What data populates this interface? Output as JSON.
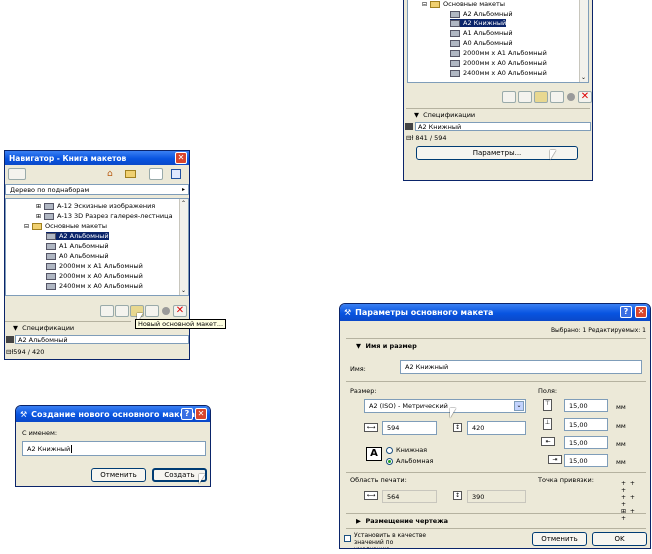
{
  "top_window": {
    "tree_root": "Основные макеты",
    "items": [
      "A2 Альбомный",
      "A2 Книжный",
      "A1 Альбомный",
      "A0 Альбомный",
      "2000мм x A1 Альбомный",
      "2000мм x A0 Альбомный",
      "2400мм x A0 Альбомный"
    ],
    "section_label": "Спецификации",
    "spec_name": "A2 Книжный",
    "spec_size": "841 / 594",
    "params_button": "Параметры..."
  },
  "navigator": {
    "title": "Навигатор - Книга макетов",
    "view_select": "Дерево по поднаборам",
    "tree_items": [
      "A-12 Эскизные изображения",
      "A-13 3D Разрез галерея-лестница",
      "Основные макеты",
      "A2 Альбомный",
      "A1 Альбомный",
      "A0 Альбомный",
      "2000мм x A1 Альбомный",
      "2000мм x A0 Альбомный",
      "2400мм x A0 Альбомный"
    ],
    "tooltip": "Новый основной макет...",
    "section_label": "Спецификации",
    "spec_name": "A2 Альбомный",
    "spec_size": "594 / 420"
  },
  "create_dialog": {
    "title": "Создание нового основного макета",
    "name_label": "С именем:",
    "name_value": "A2 Книжный",
    "cancel": "Отменить",
    "create": "Создать"
  },
  "params_dialog": {
    "title": "Параметры основного макета",
    "status": "Выбрано: 1 Редактируемых: 1",
    "section_name": "Имя и размер",
    "name_label": "Имя:",
    "name_value": "A2 Книжный",
    "size_label": "Размер:",
    "size_value": "A2 (ISO) - Метрический",
    "width": "594",
    "height": "420",
    "orientation_portrait": "Книжная",
    "orientation_landscape": "Альбомная",
    "margins_label": "Поля:",
    "margin_top": "15,00",
    "margin_bottom": "15,00",
    "margin_left": "15,00",
    "margin_right": "15,00",
    "unit": "мм",
    "print_area_label": "Область печати:",
    "print_width": "564",
    "print_height": "390",
    "anchor_label": "Точка привязки:",
    "section_drawing": "Размещение чертежа",
    "default_check": "Установить в качестве значений по умолчанию",
    "cancel": "Отменить",
    "ok": "OK"
  }
}
